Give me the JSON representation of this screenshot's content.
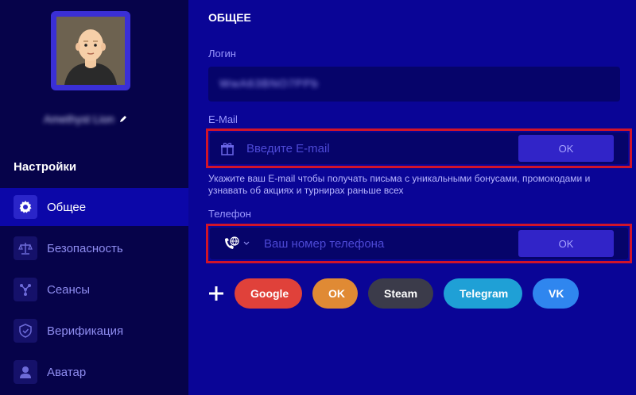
{
  "profile": {
    "username": "Amethyst Lion"
  },
  "sidebar": {
    "title": "Настройки",
    "items": [
      {
        "label": "Общее",
        "icon": "gear-icon",
        "active": true
      },
      {
        "label": "Безопасность",
        "icon": "scales-icon",
        "active": false
      },
      {
        "label": "Сеансы",
        "icon": "network-icon",
        "active": false
      },
      {
        "label": "Верификация",
        "icon": "shield-icon",
        "active": false
      },
      {
        "label": "Аватар",
        "icon": "user-icon",
        "active": false
      }
    ]
  },
  "main": {
    "title": "ОБЩЕЕ",
    "login": {
      "label": "Логин",
      "value": "WwA63BNO7PPb"
    },
    "email": {
      "label": "E-Mail",
      "placeholder": "Введите E-mail",
      "button": "OK",
      "hint": "Укажите ваш E-mail чтобы получать письма с уникальными бонусами, промокодами и узнавать об акциях и турнирах раньше всех"
    },
    "phone": {
      "label": "Телефон",
      "placeholder": "Ваш номер телефона",
      "button": "OK"
    },
    "socials": [
      {
        "label": "Google",
        "color": "#e0413a"
      },
      {
        "label": "OK",
        "color": "#e08a34"
      },
      {
        "label": "Steam",
        "color": "#3b3b4a"
      },
      {
        "label": "Telegram",
        "color": "#1fa0d6"
      },
      {
        "label": "VK",
        "color": "#2f86ef"
      }
    ]
  },
  "colors": {
    "background": "#0a0596",
    "sidebar": "#06034a",
    "accent": "#3124c8",
    "highlight": "#d1142a"
  }
}
